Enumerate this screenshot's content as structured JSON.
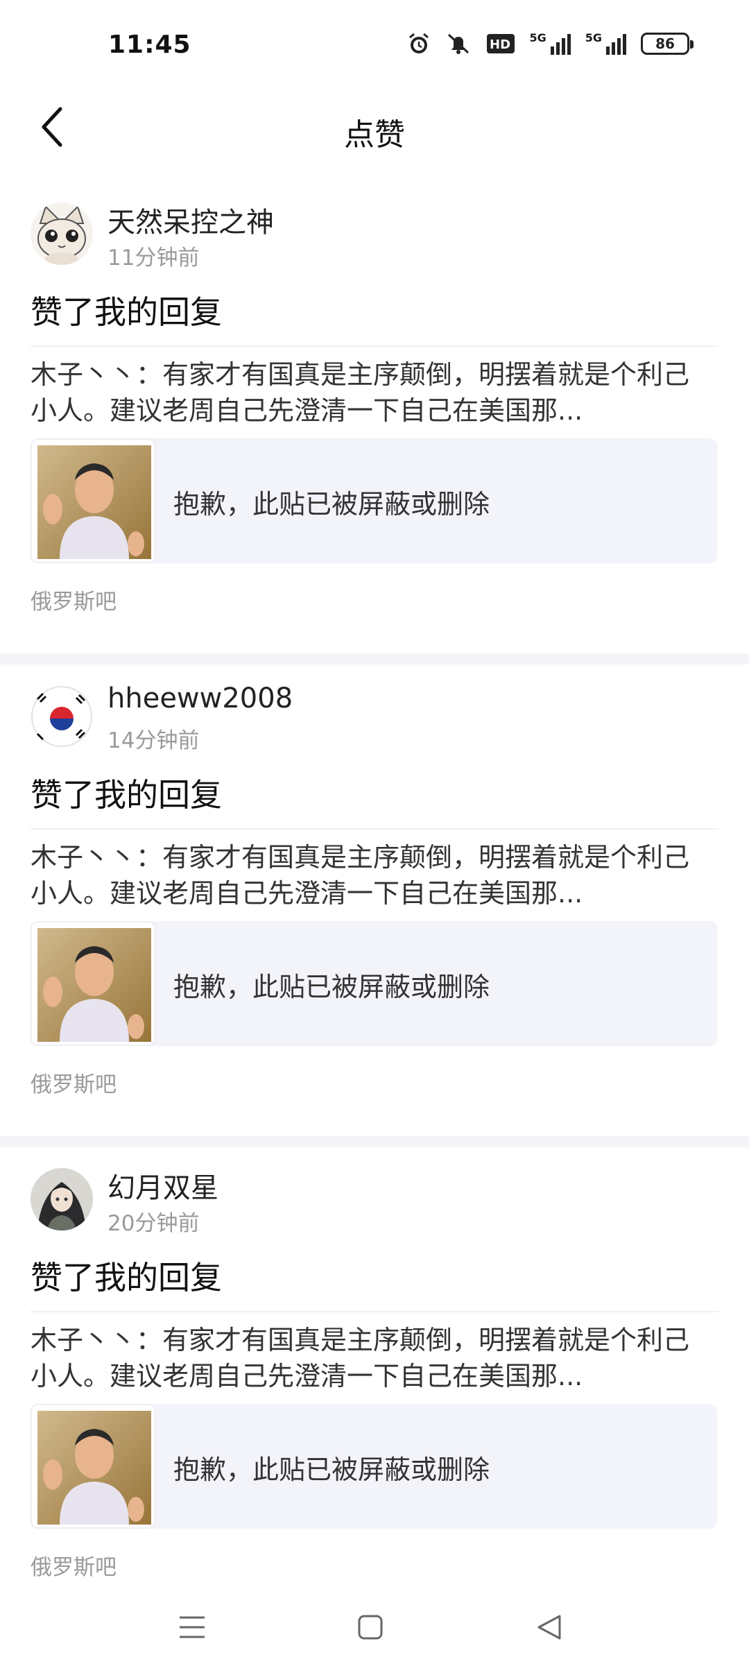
{
  "status_bar": {
    "time": "11:45",
    "network_1": "5G",
    "network_2": "5G",
    "battery": "86",
    "icons": [
      "alarm-icon",
      "mute-icon",
      "hd-icon",
      "signal-icon",
      "signal-icon",
      "battery-icon"
    ]
  },
  "header": {
    "title": "点赞",
    "back_icon": "chevron-left-icon"
  },
  "items": [
    {
      "user": "天然呆控之神",
      "time": "11分钟前",
      "action": "赞了我的回复",
      "reply": "木子丶丶：有家才有国真是主序颠倒，明摆着就是个利己小人。建议老周自己先澄清一下自己在美国那...",
      "post_status": "抱歉，此贴已被屏蔽或删除",
      "forum": "俄罗斯吧"
    },
    {
      "user": "hheeww2008",
      "time": "14分钟前",
      "action": "赞了我的回复",
      "reply": "木子丶丶：有家才有国真是主序颠倒，明摆着就是个利己小人。建议老周自己先澄清一下自己在美国那...",
      "post_status": "抱歉，此贴已被屏蔽或删除",
      "forum": "俄罗斯吧"
    },
    {
      "user": "幻月双星",
      "time": "20分钟前",
      "action": "赞了我的回复",
      "reply": "木子丶丶：有家才有国真是主序颠倒，明摆着就是个利己小人。建议老周自己先澄清一下自己在美国那...",
      "post_status": "抱歉，此贴已被屏蔽或删除",
      "forum": "俄罗斯吧"
    }
  ],
  "system_nav": {
    "icons": [
      "menu-icon",
      "home-icon",
      "back-triangle-icon"
    ]
  }
}
